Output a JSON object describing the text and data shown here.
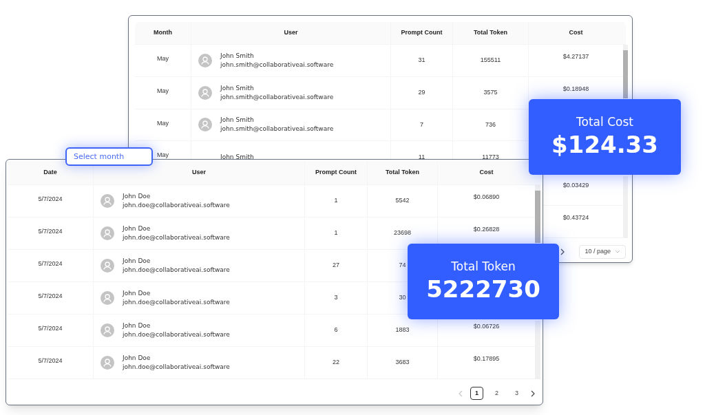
{
  "back_table": {
    "columns": [
      "Month",
      "User",
      "Prompt Count",
      "Total Token",
      "Cost"
    ],
    "rows": [
      {
        "month": "May",
        "user_name": "John Smith",
        "user_email": "john.smith@collaborativeai.software",
        "prompt_count": "31",
        "total_token": "155511",
        "cost": "$4.27137"
      },
      {
        "month": "May",
        "user_name": "John Smith",
        "user_email": "john.smith@collaborativeai.software",
        "prompt_count": "29",
        "total_token": "3575",
        "cost": "$0.18948"
      },
      {
        "month": "May",
        "user_name": "John Smith",
        "user_email": "john.smith@collaborativeai.software",
        "prompt_count": "7",
        "total_token": "736"
      },
      {
        "month": "May",
        "user_name": "John Smith",
        "prompt_count": "11",
        "total_token": "11773"
      },
      {
        "cost": "$0.03429"
      },
      {
        "cost": "$0.43724"
      }
    ],
    "pagination": {
      "next": {
        "disabled": false
      },
      "page_size": "10 / page"
    }
  },
  "month_select": {
    "placeholder": "Select month"
  },
  "front_table": {
    "columns": [
      "Date",
      "User",
      "Prompt Count",
      "Total Token",
      "Cost"
    ],
    "rows": [
      {
        "date": "5/7/2024",
        "user_name": "John Doe",
        "user_email": "john.doe@collaborativeai.software",
        "prompt_count": "1",
        "total_token": "5542",
        "cost": "$0.06890"
      },
      {
        "date": "5/7/2024",
        "user_name": "John Doe",
        "user_email": "john.doe@collaborativeai.software",
        "prompt_count": "1",
        "total_token": "23698",
        "cost": "$0.26828"
      },
      {
        "date": "5/7/2024",
        "user_name": "John Doe",
        "user_email": "john.doe@collaborativeai.software",
        "prompt_count": "27",
        "total_token": "74"
      },
      {
        "date": "5/7/2024",
        "user_name": "John Doe",
        "user_email": "john.doe@collaborativeai.software",
        "prompt_count": "3",
        "total_token": "30"
      },
      {
        "date": "5/7/2024",
        "user_name": "John Doe",
        "user_email": "john.doe@collaborativeai.software",
        "prompt_count": "6",
        "total_token": "1883",
        "cost": "$0.06726"
      },
      {
        "date": "5/7/2024",
        "user_name": "John Doe",
        "user_email": "john.doe@collaborativeai.software",
        "prompt_count": "22",
        "total_token": "3683",
        "cost": "$0.17895"
      }
    ],
    "pagination": {
      "prev": {
        "disabled": true
      },
      "pages": [
        {
          "label": "1",
          "selected": true
        },
        {
          "label": "2",
          "selected": false
        },
        {
          "label": "3",
          "selected": false
        }
      ],
      "next": {
        "disabled": false
      }
    }
  },
  "total_cost_card": {
    "label": "Total Cost",
    "value": "$124.33"
  },
  "total_token_card": {
    "label": "Total Token",
    "value": "5222730"
  }
}
